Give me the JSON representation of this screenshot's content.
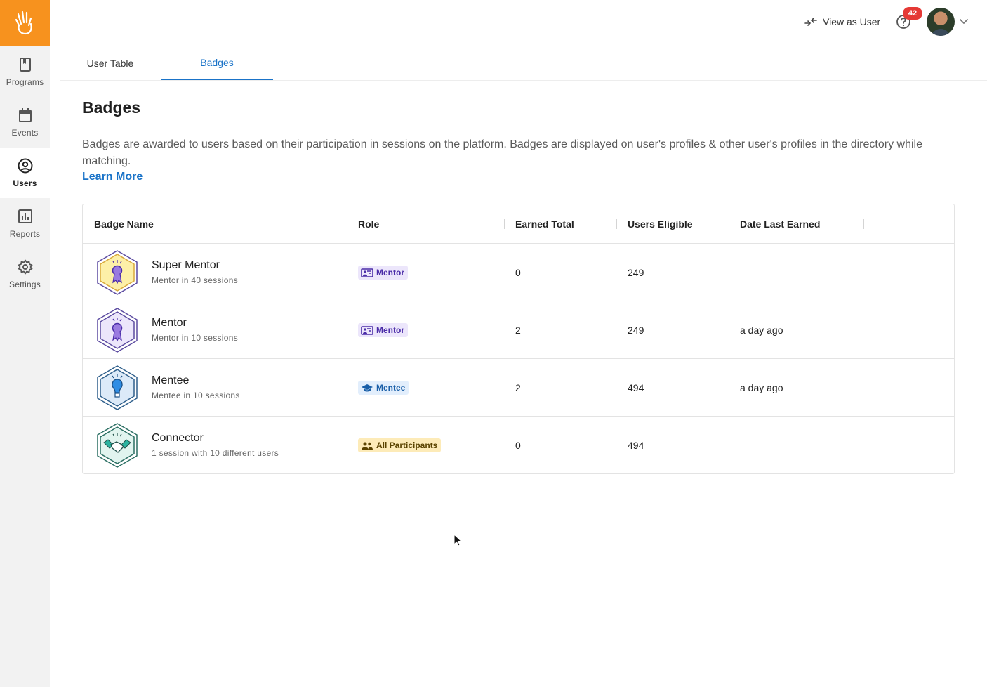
{
  "sidebar": {
    "logo_icon": "hand-wave-icon",
    "brand_color": "#f7921e",
    "items": [
      {
        "label": "Programs",
        "icon": "book-icon"
      },
      {
        "label": "Events",
        "icon": "calendar-icon"
      },
      {
        "label": "Users",
        "icon": "user-circle-icon",
        "active": true
      },
      {
        "label": "Reports",
        "icon": "bar-chart-icon"
      },
      {
        "label": "Settings",
        "icon": "gear-icon"
      }
    ]
  },
  "topbar": {
    "view_as_user": "View as User",
    "notification_count": "42"
  },
  "tabs": [
    {
      "label": "User Table"
    },
    {
      "label": "Badges",
      "active": true
    }
  ],
  "page": {
    "title": "Badges",
    "description": "Badges are awarded to users based on their participation in sessions on the platform. Badges are displayed on user's profiles & other user's profiles in the directory while matching.",
    "learn_more": "Learn More"
  },
  "table": {
    "columns": [
      "Badge Name",
      "Role",
      "Earned Total",
      "Users Eligible",
      "Date Last Earned"
    ],
    "rows": [
      {
        "name": "Super Mentor",
        "subtitle": "Mentor in 40 sessions",
        "role": "Mentor",
        "earned_total": "0",
        "users_eligible": "249",
        "date_last_earned": ""
      },
      {
        "name": "Mentor",
        "subtitle": "Mentor in 10 sessions",
        "role": "Mentor",
        "earned_total": "2",
        "users_eligible": "249",
        "date_last_earned": "a day ago"
      },
      {
        "name": "Mentee",
        "subtitle": "Mentee in 10 sessions",
        "role": "Mentee",
        "earned_total": "2",
        "users_eligible": "494",
        "date_last_earned": "a day ago"
      },
      {
        "name": "Connector",
        "subtitle": "1 session with 10 different users",
        "role": "All Participants",
        "earned_total": "0",
        "users_eligible": "494",
        "date_last_earned": ""
      }
    ]
  },
  "colors": {
    "accent": "#1a73c8",
    "notification": "#e53935"
  }
}
